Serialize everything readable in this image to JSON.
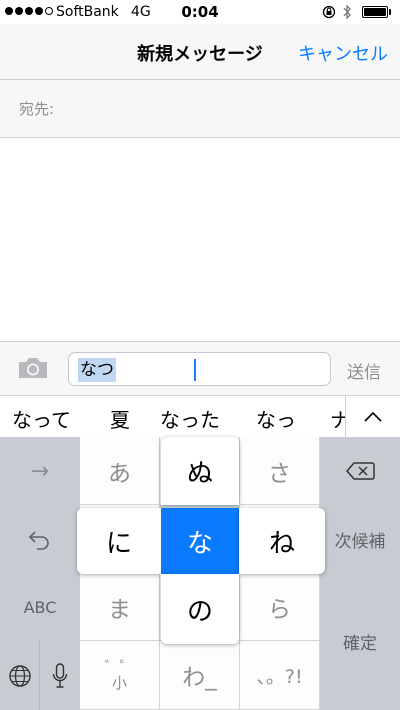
{
  "status_bar": {
    "carrier": "SoftBank",
    "network": "4G",
    "time": "0:04",
    "signal_bars_filled": 4,
    "signal_bars_total": 5,
    "battery_level": 1.0
  },
  "nav": {
    "title": "新規メッセージ",
    "cancel_label": "キャンセル"
  },
  "to_field": {
    "label": "宛先:"
  },
  "compose": {
    "text": "なつ",
    "send_label": "送信"
  },
  "candidates": {
    "items": [
      "なって",
      "夏",
      "なった",
      "なっ",
      "ナ"
    ]
  },
  "keyboard": {
    "arrow": "→",
    "abc": "ABC",
    "next_candidate": "次候補",
    "confirm": "確定",
    "keys": {
      "a": "あ",
      "sa": "さ",
      "ma": "ま",
      "ra": "ら",
      "ha": "゛゜\n小",
      "wa": "わ_",
      "punct": "、。?!"
    },
    "flick_popup": {
      "up": "ぬ",
      "left": "に",
      "center": "な",
      "right": "ね",
      "down": "の"
    }
  },
  "colors": {
    "accent": "#0a7aff",
    "keyboard_bg": "#d1d5db"
  }
}
